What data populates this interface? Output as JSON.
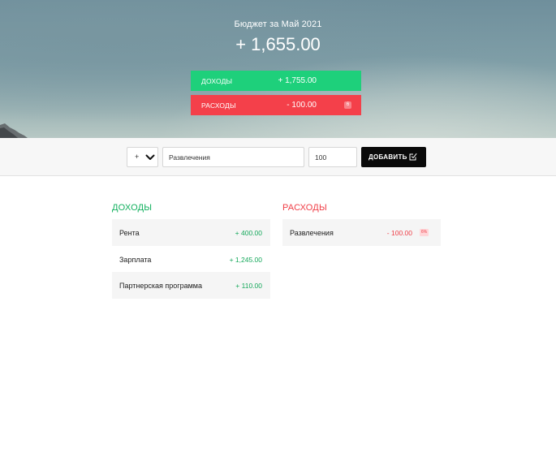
{
  "header": {
    "title": "Бюджет за Май 2021",
    "total": "+ 1,655.00",
    "income": {
      "label": "Доходы",
      "value": "+ 1,755.00"
    },
    "expense": {
      "label": "Расходы",
      "value": "- 100.00",
      "percentage": "6"
    }
  },
  "add_form": {
    "type_value": "+",
    "description_value": "Развлечения",
    "amount_value": "100",
    "add_button_label": "Добавить"
  },
  "income_list": {
    "title": "Доходы",
    "items": [
      {
        "description": "Рента",
        "value": "+ 400.00"
      },
      {
        "description": "Зарплата",
        "value": "+ 1,245.00"
      },
      {
        "description": "Партнерская программа",
        "value": "+ 110.00"
      }
    ]
  },
  "expense_list": {
    "title": "Расходы",
    "items": [
      {
        "description": "Развлечения",
        "value": "- 100.00",
        "percentage": "6%"
      }
    ]
  },
  "colors": {
    "income": "#1ed07b",
    "expense": "#f4404a",
    "button": "#0a0a0a"
  },
  "icons": {
    "add_button": "check-square-icon",
    "select": "chevron-down-icon"
  }
}
